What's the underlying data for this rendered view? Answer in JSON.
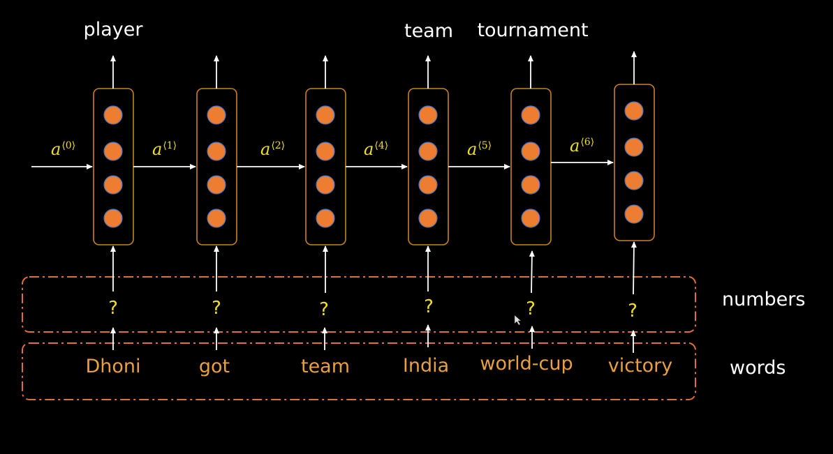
{
  "outputs": [
    "player",
    "",
    "",
    "team",
    "tournament",
    ""
  ],
  "activations": [
    {
      "base": "a",
      "sup": "⟨0⟩"
    },
    {
      "base": "a",
      "sup": "⟨1⟩"
    },
    {
      "base": "a",
      "sup": "⟨2⟩"
    },
    {
      "base": "a",
      "sup": "⟨4⟩"
    },
    {
      "base": "a",
      "sup": "⟨5⟩"
    },
    {
      "base": "a",
      "sup": "⟨6⟩"
    }
  ],
  "encodings": [
    "?",
    "?",
    "?",
    "?",
    "?",
    "?"
  ],
  "words": [
    "Dhoni",
    "got",
    "team",
    "India",
    "world-cup",
    "victory"
  ],
  "bands": {
    "numbers": "numbers",
    "words": "words"
  },
  "colors": {
    "background": "#000000",
    "cell_border": "#c8821e",
    "node_fill": "#ed7d31",
    "node_stroke": "#4472c4",
    "arrow": "#ffffff",
    "band_border": "#e07035",
    "activation_text": "#f0e020",
    "word_text": "#e8a040"
  }
}
